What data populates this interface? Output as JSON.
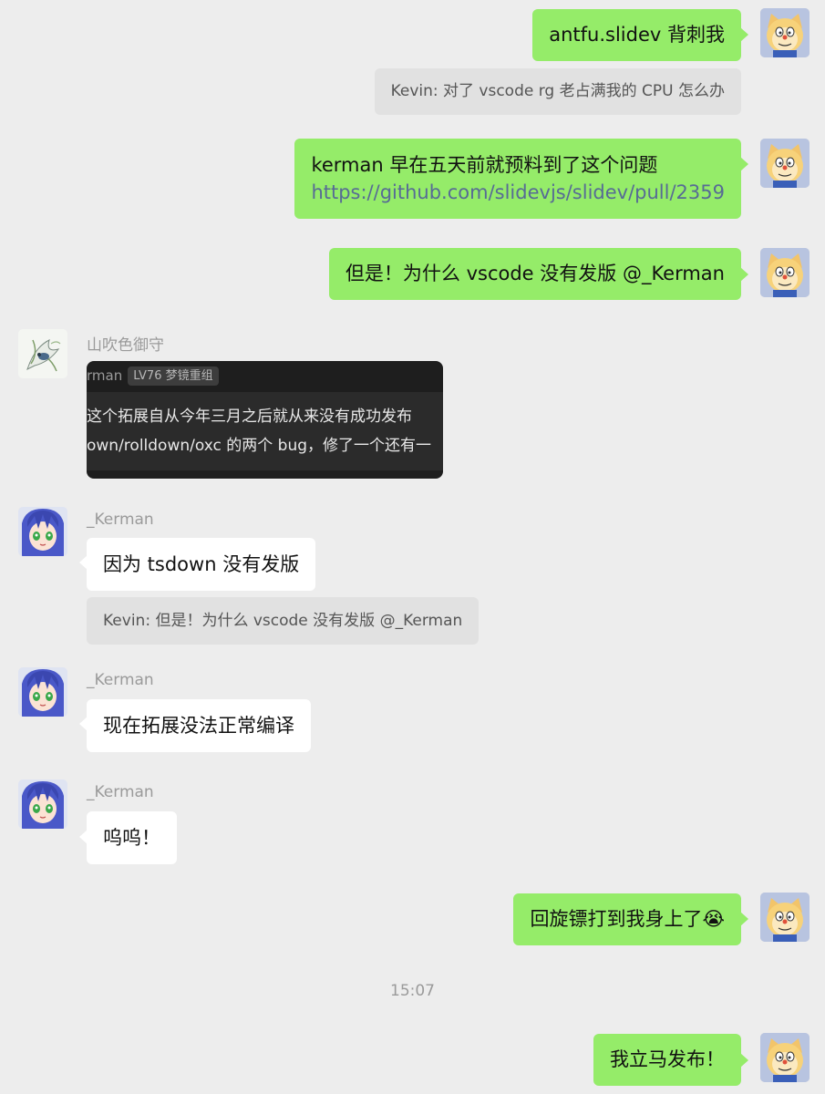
{
  "messages": {
    "m1": {
      "text": "antfu.slidev 背刺我"
    },
    "q1": {
      "text": "Kevin: 对了 vscode rg 老占满我的 CPU 怎么办"
    },
    "m2": {
      "line1": "kerman 早在五天前就预料到了这个问题",
      "link": "https://github.com/slidevjs/slidev/pull/2359"
    },
    "m3": {
      "text": "但是！为什么 vscode 没有发版  @_Kerman"
    },
    "m4": {
      "sender": "山吹色御守",
      "shot_user": "rman",
      "shot_badge": "LV76 梦镜重组",
      "shot_line1": "这个拓展自从今年三月之后就从来没有成功发布",
      "shot_line2": "own/rolldown/oxc 的两个 bug，修了一个还有一"
    },
    "m5": {
      "sender": "_Kerman",
      "text": "因为 tsdown 没有发版",
      "quote": "Kevin: 但是！为什么 vscode 没有发版  @_Kerman"
    },
    "m6": {
      "sender": "_Kerman",
      "text": "现在拓展没法正常编译"
    },
    "m7": {
      "sender": "_Kerman",
      "text": "呜呜！"
    },
    "m8": {
      "text": "回旋镖打到我身上了😭"
    },
    "time": "15:07",
    "m9": {
      "text": "我立马发布！"
    }
  },
  "colors": {
    "self_bubble": "#95ec69",
    "other_bubble": "#ffffff",
    "background": "#ededed",
    "link": "#576b95"
  },
  "icons": {
    "self_avatar": "doraemon-cat-avatar",
    "kerman_avatar": "anime-girl-avatar",
    "yamabuki_avatar": "white-bird-avatar"
  }
}
